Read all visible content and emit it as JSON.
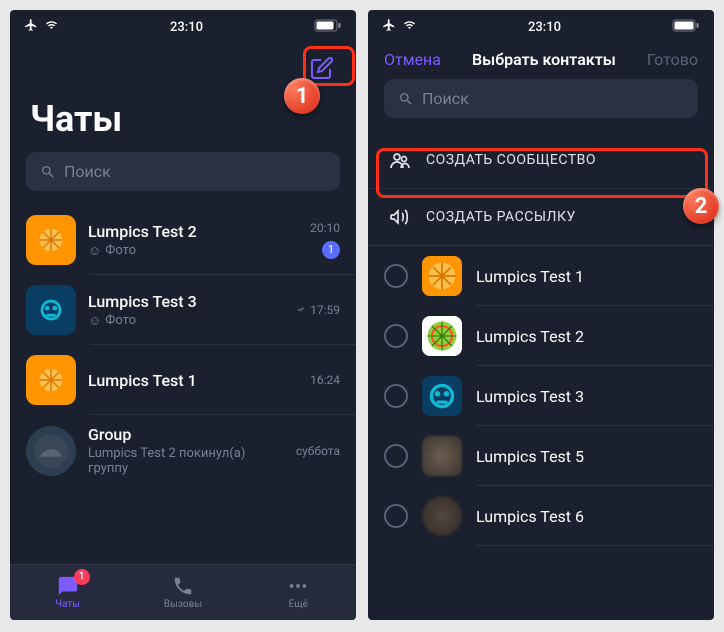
{
  "status_time": "23:10",
  "left": {
    "title": "Чаты",
    "search_placeholder": "Поиск",
    "compose_icon": "compose",
    "chats": [
      {
        "name": "Lumpics Test 2",
        "preview_icon": "photo",
        "preview": "Фото",
        "time": "20:10",
        "badge": "1",
        "avatar": "orange"
      },
      {
        "name": "Lumpics Test 3",
        "preview_icon": "photo",
        "preview": "Фото",
        "time": "17:59",
        "check": true,
        "avatar": "blue"
      },
      {
        "name": "Lumpics Test 1",
        "preview_icon": "",
        "preview": "",
        "time": "16:24",
        "avatar": "orange"
      },
      {
        "name": "Group",
        "preview": "Lumpics Test 2 покинул(а) группу",
        "time": "суббота",
        "avatar": "dark"
      }
    ],
    "nav": {
      "chats": "Чаты",
      "calls": "Вызовы",
      "more": "Ещё",
      "badge": "1"
    }
  },
  "right": {
    "cancel": "Отмена",
    "title": "Выбрать контакты",
    "done": "Готово",
    "search_placeholder": "Поиск",
    "create_community": "СОЗДАТЬ СООБЩЕСТВО",
    "create_broadcast": "СОЗДАТЬ РАССЫЛКУ",
    "contacts": [
      {
        "name": "Lumpics Test 1",
        "avatar": "orange"
      },
      {
        "name": "Lumpics Test 2",
        "avatar": "green"
      },
      {
        "name": "Lumpics Test 3",
        "avatar": "blue"
      },
      {
        "name": "Lumpics Test 5",
        "avatar": "blur1"
      },
      {
        "name": "Lumpics Test 6",
        "avatar": "blur2"
      }
    ]
  },
  "markers": {
    "m1": "1",
    "m2": "2"
  }
}
